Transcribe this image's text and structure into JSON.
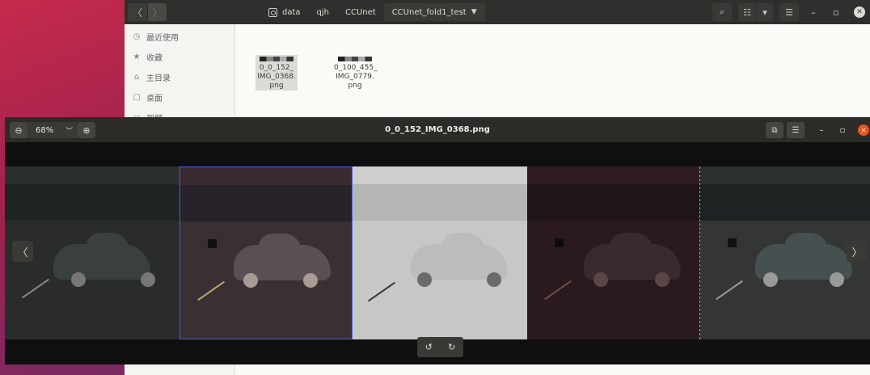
{
  "file_manager": {
    "nav": {
      "back": "〈",
      "forward": "〉"
    },
    "breadcrumbs": [
      {
        "label": "data",
        "icon": "home-drive-icon"
      },
      {
        "label": "qjh"
      },
      {
        "label": "CCUnet"
      },
      {
        "label": "CCUnet_fold1_test",
        "active": true
      }
    ],
    "sidebar": [
      {
        "icon": "clock-icon",
        "glyph": "◷",
        "label": "最近使用"
      },
      {
        "icon": "star-icon",
        "glyph": "★",
        "label": "收藏"
      },
      {
        "icon": "home-icon",
        "glyph": "⌂",
        "label": "主目录"
      },
      {
        "icon": "desktop-icon",
        "glyph": "▢",
        "label": "桌面"
      },
      {
        "icon": "video-icon",
        "glyph": "▭",
        "label": "视频"
      }
    ],
    "files": [
      {
        "name_lines": [
          "0_0_152_",
          "IMG_0368.",
          "png"
        ],
        "selected": true
      },
      {
        "name_lines": [
          "0_100_455_",
          "IMG_0779.",
          "png"
        ],
        "selected": false
      }
    ]
  },
  "viewer": {
    "title": "0_0_152_IMG_0368.png",
    "zoom": "68%",
    "zoom_out": "⊖",
    "zoom_in": "⊕",
    "zoom_chevron": "﹀",
    "menu": "☰",
    "gallery": "⧉",
    "minimize": "–",
    "maximize": "▫",
    "close": "✕",
    "prev": "〈",
    "next": "〉",
    "rotate_left": "↺",
    "rotate_right": "↻"
  }
}
